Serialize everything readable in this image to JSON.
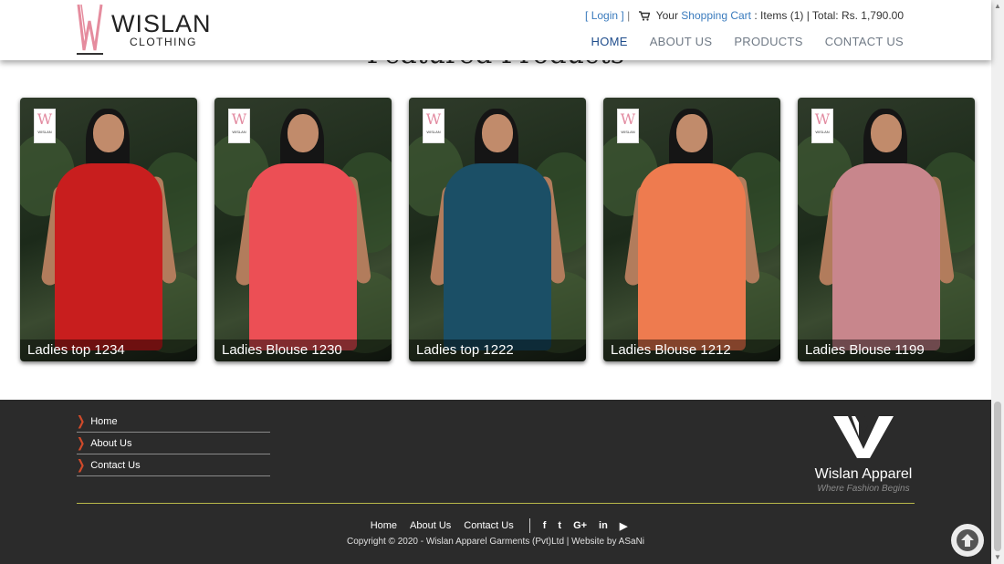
{
  "header": {
    "brand": "WISLAN",
    "brand_sub": "CLOTHING",
    "login_open": "[",
    "login_label": "Login",
    "login_close": "]",
    "divider": "|",
    "cart_prefix": "Your",
    "cart_label": "Shopping Cart",
    "cart_summary": ": Items (1) | Total: Rs. 1,790.00",
    "nav": [
      "HOME",
      "ABOUT US",
      "PRODUCTS",
      "CONTACT US"
    ],
    "active_nav": "HOME"
  },
  "featured": {
    "title": "Featured Products",
    "products": [
      {
        "name": "Ladies top 1234",
        "color": "#c81e1e"
      },
      {
        "name": "Ladies Blouse 1230",
        "color": "#ec4f55"
      },
      {
        "name": "Ladies top 1222",
        "color": "#1b4f66"
      },
      {
        "name": "Ladies Blouse 1212",
        "color": "#ee7b4f"
      },
      {
        "name": "Ladies Blouse 1199",
        "color": "#c8868c"
      }
    ],
    "thumb_logo_letter": "W",
    "thumb_logo_text": "WISLAN"
  },
  "footer": {
    "links": [
      "Home",
      "About Us",
      "Contact Us"
    ],
    "brand_name": "Wislan Apparel",
    "brand_tagline": "Where Fashion Begins",
    "bottom_links": [
      "Home",
      "About Us",
      "Contact Us"
    ],
    "social_icons": [
      "facebook-icon",
      "twitter-icon",
      "google-plus-icon",
      "linkedin-icon",
      "youtube-icon"
    ],
    "social_glyphs": [
      "f",
      "t",
      "G+",
      "in",
      "▶"
    ],
    "copyright": "Copyright © 2020 - Wislan Apparel Garments (Pvt)Ltd  |  Website by ASaNi"
  },
  "colors": {
    "nav_active": "#1f4d8c",
    "link_blue": "#3a7bbd",
    "footer_bg": "#2b2b2b",
    "footer_divider": "#b9b84a",
    "chevron": "#d04a2a"
  }
}
